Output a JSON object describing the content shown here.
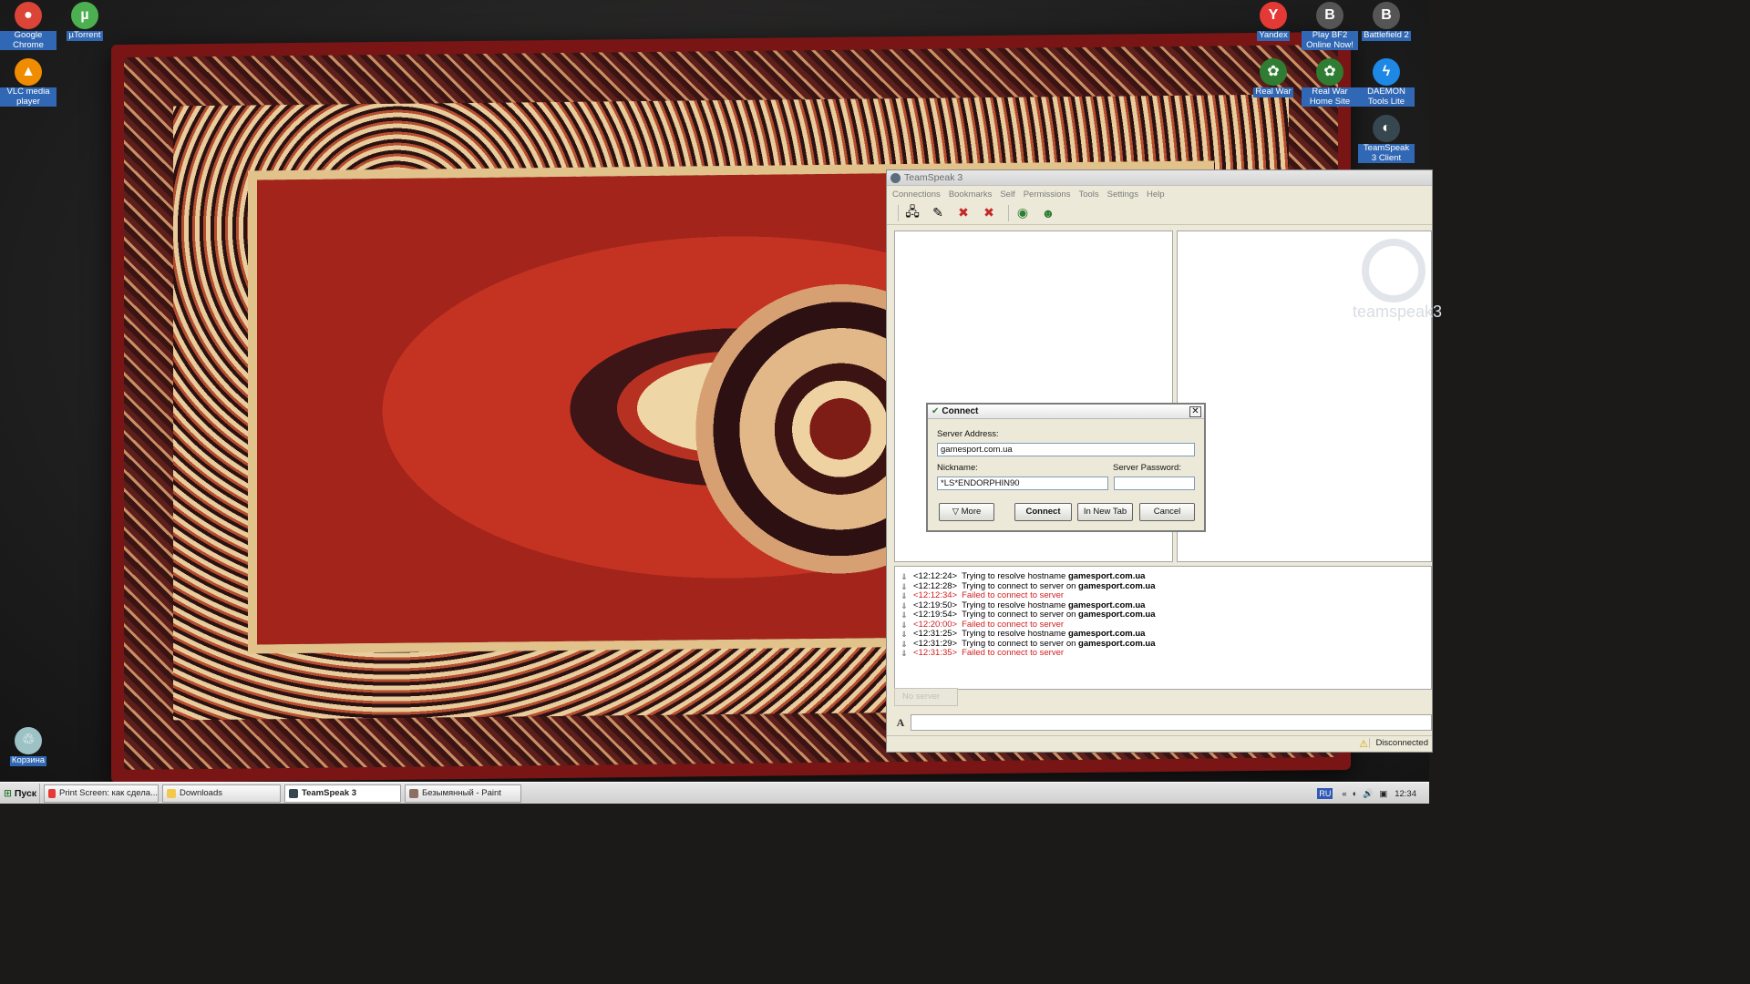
{
  "desktop_icons": [
    {
      "label": "Google Chrome",
      "color": "#db4437",
      "glyph": "●",
      "side": "left"
    },
    {
      "label": "µTorrent",
      "color": "#4caf50",
      "glyph": "µ",
      "side": "left"
    },
    {
      "label": "VLC media player",
      "color": "#f08c00",
      "glyph": "▲",
      "side": "left"
    },
    {
      "label": "Корзина",
      "color": "#9cc2c6",
      "glyph": "♲",
      "side": "left"
    },
    {
      "label": "Yandex",
      "color": "#e53935",
      "glyph": "Y",
      "side": "right"
    },
    {
      "label": "Play BF2 Online Now!",
      "color": "#555555",
      "glyph": "B",
      "side": "right"
    },
    {
      "label": "Battlefield 2",
      "color": "#555555",
      "glyph": "B",
      "side": "right"
    },
    {
      "label": "Real War",
      "color": "#2e7d32",
      "glyph": "✿",
      "side": "right"
    },
    {
      "label": "Real War Home Site",
      "color": "#2e7d32",
      "glyph": "✿",
      "side": "right"
    },
    {
      "label": "DAEMON Tools Lite",
      "color": "#1e88e5",
      "glyph": "ϟ",
      "side": "right"
    },
    {
      "label": "TeamSpeak 3 Client",
      "color": "#37474f",
      "glyph": "◐",
      "side": "right"
    }
  ],
  "teamspeak": {
    "title": "TeamSpeak 3",
    "menu": [
      "Connections",
      "Bookmarks",
      "Self",
      "Permissions",
      "Tools",
      "Settings",
      "Help"
    ],
    "info_logo_text": "teamspeak3",
    "log": [
      {
        "time": "<12:12:24>",
        "text": "Trying to resolve hostname ",
        "host": "gamesport.com.ua",
        "error": false
      },
      {
        "time": "<12:12:28>",
        "text": "Trying to connect to server on ",
        "host": "gamesport.com.ua",
        "error": false
      },
      {
        "time": "<12:12:34>",
        "text": "Failed to connect to server",
        "host": "",
        "error": true
      },
      {
        "time": "<12:19:50>",
        "text": "Trying to resolve hostname ",
        "host": "gamesport.com.ua",
        "error": false
      },
      {
        "time": "<12:19:54>",
        "text": "Trying to connect to server on ",
        "host": "gamesport.com.ua",
        "error": false
      },
      {
        "time": "<12:20:00>",
        "text": "Failed to connect to server",
        "host": "",
        "error": true
      },
      {
        "time": "<12:31:25>",
        "text": "Trying to resolve hostname ",
        "host": "gamesport.com.ua",
        "error": false
      },
      {
        "time": "<12:31:29>",
        "text": "Trying to connect to server on ",
        "host": "gamesport.com.ua",
        "error": false
      },
      {
        "time": "<12:31:35>",
        "text": "Failed to connect to server",
        "host": "",
        "error": true
      }
    ],
    "tab_label": "No server",
    "status": "Disconnected"
  },
  "connect_dialog": {
    "title": "Connect",
    "server_address_label": "Server Address:",
    "server_address_value": "gamesport.com.ua",
    "nickname_label": "Nickname:",
    "nickname_value": "*LS*ENDORPHIN90",
    "password_label": "Server Password:",
    "password_value": "",
    "more_label": "▽ More",
    "connect_label": "Connect",
    "new_tab_label": "In New Tab",
    "cancel_label": "Cancel"
  },
  "taskbar": {
    "start_label": "Пуск",
    "tasks": [
      {
        "label": "Print Screen: как сдела...",
        "active": false,
        "color": "#e53935"
      },
      {
        "label": "Downloads",
        "active": false,
        "color": "#f2c94c"
      },
      {
        "label": "TeamSpeak 3",
        "active": true,
        "color": "#37474f"
      },
      {
        "label": "Безымянный - Paint",
        "active": false,
        "color": "#8d6e63"
      }
    ],
    "lang": "RU",
    "clock": "12:34"
  }
}
